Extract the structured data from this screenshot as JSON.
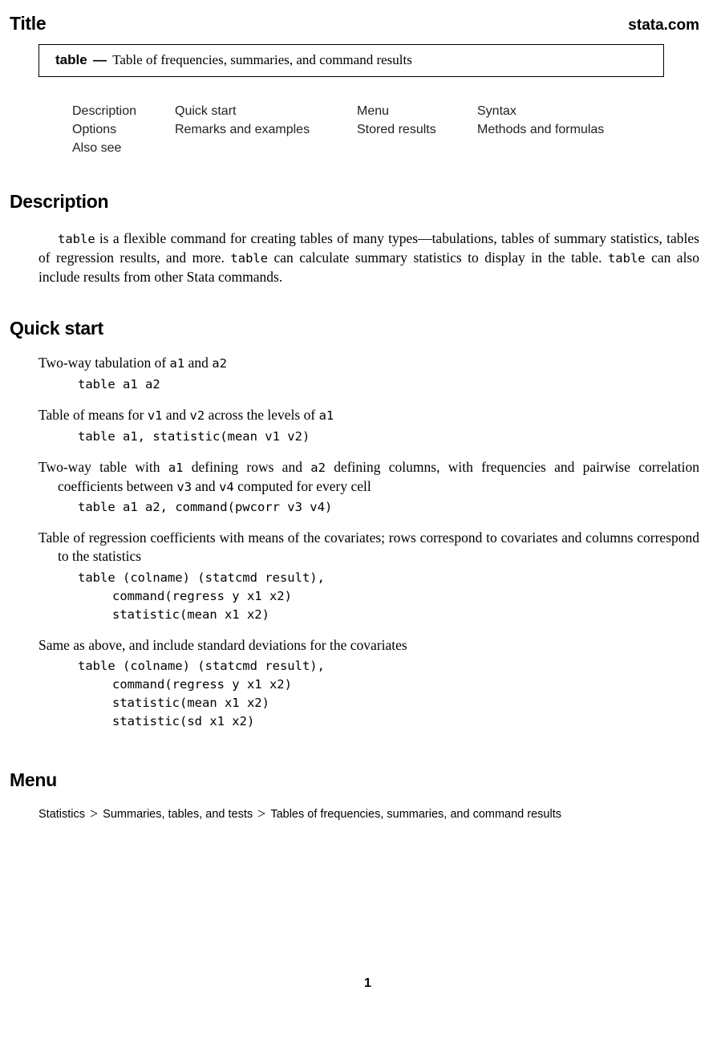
{
  "header": {
    "section_title": "Title",
    "site": "stata.com"
  },
  "title_box": {
    "command": "table",
    "dash": "—",
    "description": "Table of frequencies, summaries, and command results"
  },
  "toc": {
    "rows": [
      [
        "Description",
        "Quick start",
        "Menu",
        "Syntax"
      ],
      [
        "Options",
        "Remarks and examples",
        "Stored results",
        "Methods and formulas"
      ],
      [
        "Also see"
      ]
    ]
  },
  "description": {
    "heading": "Description",
    "parts": [
      {
        "type": "code",
        "text": "table"
      },
      {
        "type": "text",
        "text": " is a flexible command for creating tables of many types—tabulations, tables of summary statistics, tables of regression results, and more. "
      },
      {
        "type": "code",
        "text": "table"
      },
      {
        "type": "text",
        "text": " can calculate summary statistics to display in the table. "
      },
      {
        "type": "code",
        "text": "table"
      },
      {
        "type": "text",
        "text": " can also include results from other Stata commands."
      }
    ]
  },
  "quick_start": {
    "heading": "Quick start",
    "items": [
      {
        "label_parts": [
          {
            "type": "text",
            "text": "Two-way tabulation of "
          },
          {
            "type": "code",
            "text": "a1"
          },
          {
            "type": "text",
            "text": " and "
          },
          {
            "type": "code",
            "text": "a2"
          }
        ],
        "code": [
          "table a1 a2"
        ]
      },
      {
        "label_parts": [
          {
            "type": "text",
            "text": "Table of means for "
          },
          {
            "type": "code",
            "text": "v1"
          },
          {
            "type": "text",
            "text": " and "
          },
          {
            "type": "code",
            "text": "v2"
          },
          {
            "type": "text",
            "text": " across the levels of "
          },
          {
            "type": "code",
            "text": "a1"
          }
        ],
        "code": [
          "table a1, statistic(mean v1 v2)"
        ]
      },
      {
        "label_parts": [
          {
            "type": "text",
            "text": "Two-way table with "
          },
          {
            "type": "code",
            "text": "a1"
          },
          {
            "type": "text",
            "text": " defining rows and "
          },
          {
            "type": "code",
            "text": "a2"
          },
          {
            "type": "text",
            "text": " defining columns, with frequencies and pairwise correlation coefficients between "
          },
          {
            "type": "code",
            "text": "v3"
          },
          {
            "type": "text",
            "text": " and "
          },
          {
            "type": "code",
            "text": "v4"
          },
          {
            "type": "text",
            "text": " computed for every cell"
          }
        ],
        "code": [
          "table a1 a2, command(pwcorr v3 v4)"
        ]
      },
      {
        "label_parts": [
          {
            "type": "text",
            "text": "Table of regression coefficients with means of the covariates; rows correspond to covariates and columns correspond to the statistics"
          }
        ],
        "code": [
          "table (colname) (statcmd result),",
          "    command(regress y x1 x2)",
          "    statistic(mean x1 x2)"
        ]
      },
      {
        "label_parts": [
          {
            "type": "text",
            "text": "Same as above, and include standard deviations for the covariates"
          }
        ],
        "code": [
          "table (colname) (statcmd result),",
          "    command(regress y x1 x2)",
          "    statistic(mean x1 x2)",
          "    statistic(sd x1 x2)"
        ]
      }
    ]
  },
  "menu": {
    "heading": "Menu",
    "path": [
      "Statistics",
      "Summaries, tables, and tests",
      "Tables of frequencies, summaries, and command results"
    ],
    "separator": ">"
  },
  "footer": {
    "page_number": "1"
  }
}
